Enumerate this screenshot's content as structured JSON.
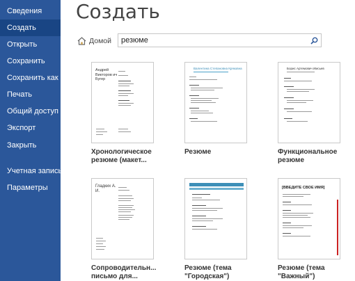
{
  "sidebar": {
    "items": [
      {
        "label": "Сведения"
      },
      {
        "label": "Создать"
      },
      {
        "label": "Открыть"
      },
      {
        "label": "Сохранить"
      },
      {
        "label": "Сохранить как"
      },
      {
        "label": "Печать"
      },
      {
        "label": "Общий доступ"
      },
      {
        "label": "Экспорт"
      },
      {
        "label": "Закрыть"
      },
      {
        "label": "Учетная запись"
      },
      {
        "label": "Параметры"
      }
    ],
    "active_index": 1,
    "bg_color": "#2b579a",
    "active_color": "#194584"
  },
  "main": {
    "title": "Создать",
    "home_label": "Домой",
    "search": {
      "value": "резюме"
    },
    "templates": [
      {
        "line1": "Хронологическое",
        "line2": "резюме (макет...",
        "thumb_text": "Андрей Викторов ич Бугер"
      },
      {
        "line1": "Резюме",
        "line2": "",
        "thumb_text": "Валентина Степановна Кряковна"
      },
      {
        "line1": "Функциональное",
        "line2": "резюме",
        "thumb_text": "Борис Артемович Имсьев"
      },
      {
        "line1": "Сопроводительн...",
        "line2": "письмо для...",
        "thumb_text": "Гладких А. И."
      },
      {
        "line1": "Резюме (тема",
        "line2": "\"Городская\")",
        "thumb_text": ""
      },
      {
        "line1": "Резюме (тема",
        "line2": "\"Важный\")",
        "thumb_text": "[ВВЕДИТЕ СВОЕ ИМЯ]"
      }
    ]
  }
}
